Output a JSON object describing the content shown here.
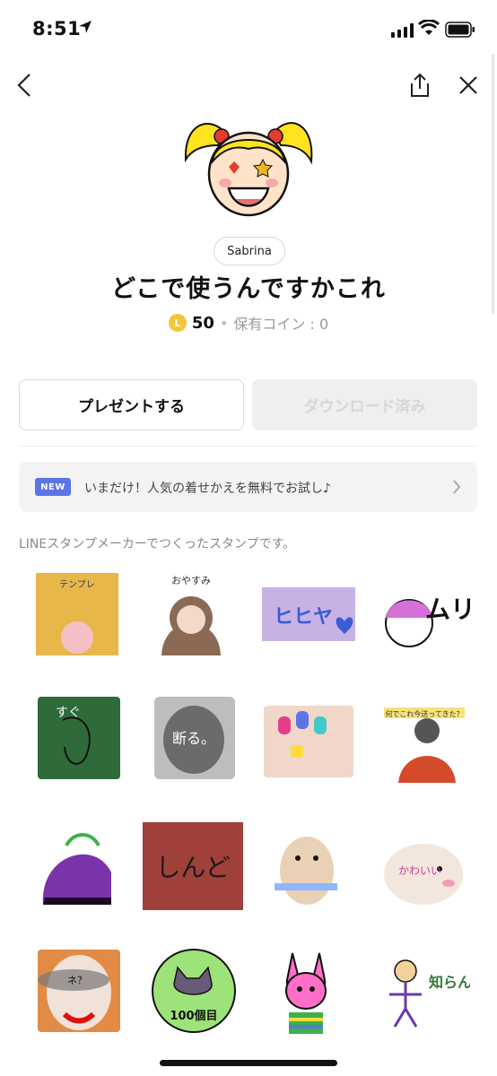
{
  "status_bar": {
    "time": "8:51"
  },
  "product": {
    "author": "Sabrina",
    "title": "どこで使うんですかこれ",
    "coin_symbol": "L",
    "price": "50",
    "owned_coins": "保有コイン : 0"
  },
  "buttons": {
    "present": "プレゼントする",
    "download": "ダウンロード済み"
  },
  "promo": {
    "badge": "NEW",
    "text": "いまだけ！人気の着せかえを無料でお試し♪"
  },
  "description": "LINEスタンプメーカーでつくったスタンプです。",
  "stickers": [
    {
      "text": "テンプレ",
      "bg": "#e8b74a"
    },
    {
      "text": "おやすみ",
      "bg": "#ffffff"
    },
    {
      "text": "ヒヒヤ",
      "bg": "#c7b2e6"
    },
    {
      "text": "ムリ",
      "bg": "#ffffff"
    },
    {
      "text": "すぐ",
      "bg": "#2f6b3a"
    },
    {
      "text": "断る。",
      "bg": "#bdbdbd"
    },
    {
      "text": "",
      "bg": "#f1d7c9"
    },
    {
      "text": "何でこれ今送ってきた？",
      "bg": "#d9d9d9"
    },
    {
      "text": "",
      "bg": "#7a33a8"
    },
    {
      "text": "しんど",
      "bg": "#a0403a"
    },
    {
      "text": "",
      "bg": "#e9d1b6"
    },
    {
      "text": "かわいい",
      "bg": "#f3e6dd"
    },
    {
      "text": "ネ？",
      "bg": "#e28b46"
    },
    {
      "text": "100個目",
      "bg": "#9ee37a"
    },
    {
      "text": "",
      "bg": "#ff6fc8"
    },
    {
      "text": "知らん",
      "bg": "#ffffff"
    }
  ]
}
